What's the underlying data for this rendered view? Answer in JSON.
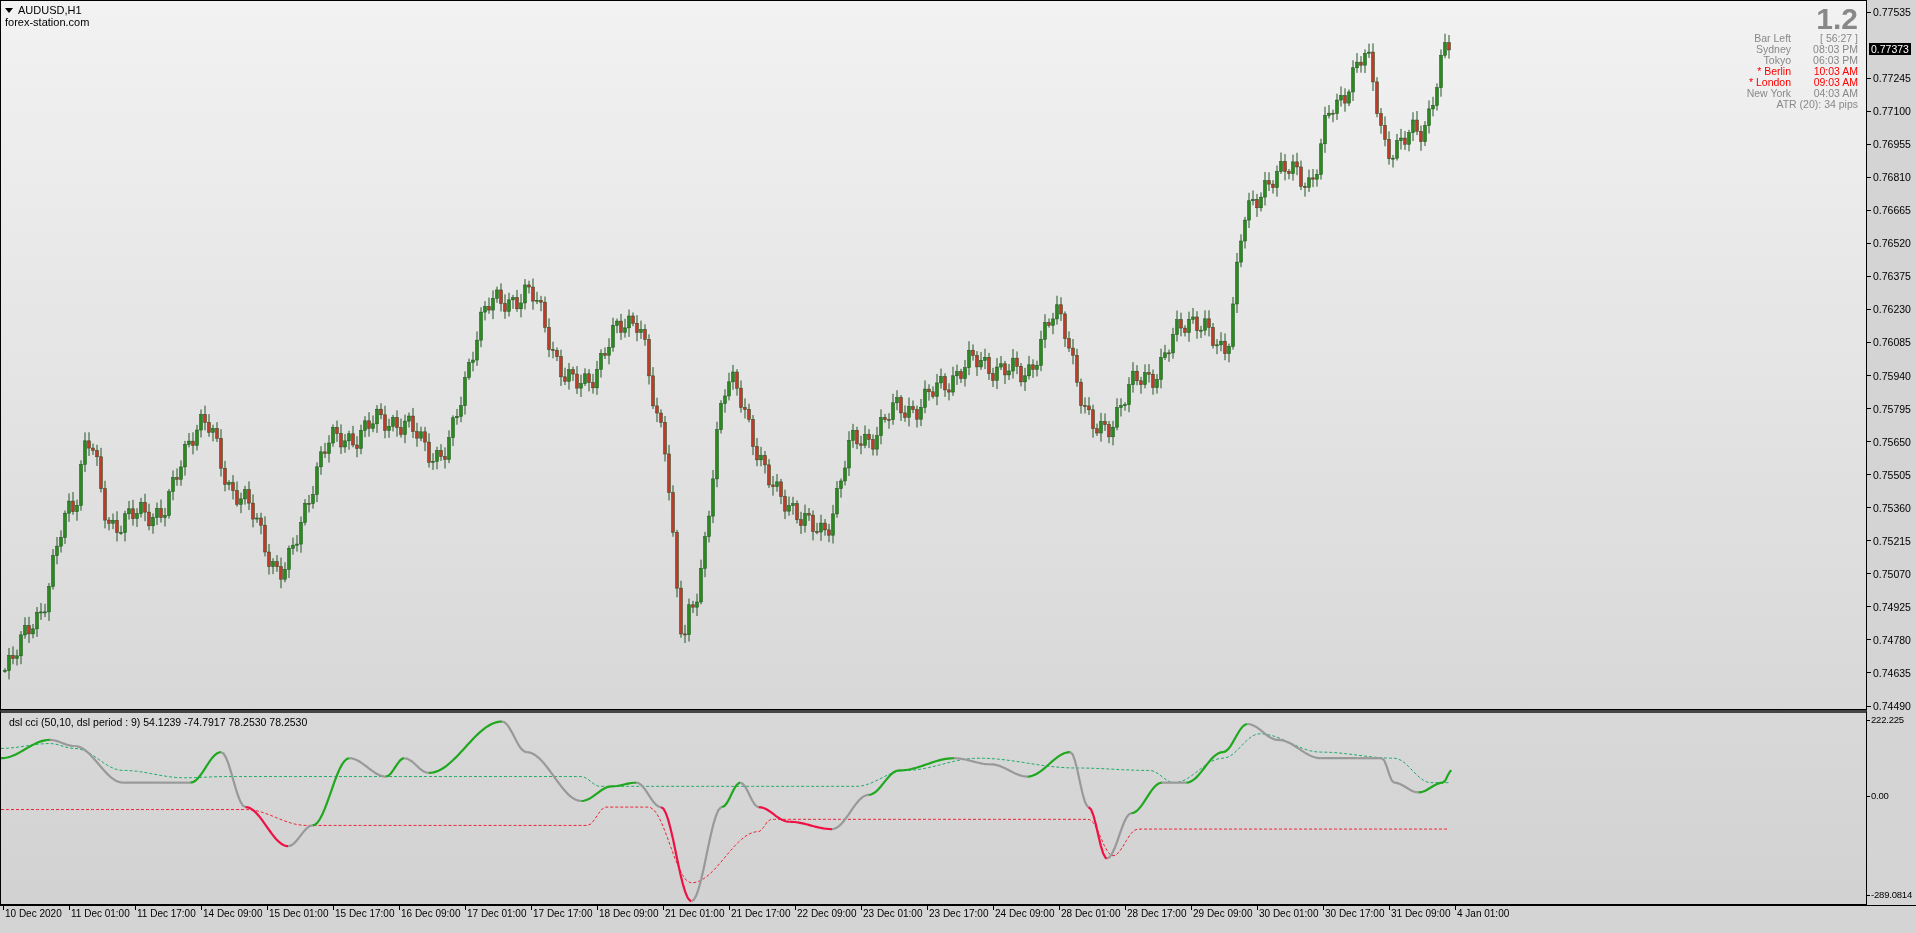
{
  "chart": {
    "title": "AUDUSD,H1",
    "source": "forex-station.com"
  },
  "info_panel": {
    "version": "1.2",
    "rows": [
      {
        "label": "Bar Left",
        "value": "[ 56:27 ]",
        "highlighted": false
      },
      {
        "label": "Sydney",
        "value": "08:03 PM",
        "highlighted": false
      },
      {
        "label": "Tokyo",
        "value": "06:03 PM",
        "highlighted": false
      },
      {
        "label": "* Berlin",
        "value": "10:03 AM",
        "highlighted": true
      },
      {
        "label": "* London",
        "value": "09:03 AM",
        "highlighted": true
      },
      {
        "label": "New York",
        "value": "04:03 AM",
        "highlighted": false
      }
    ],
    "footer": "ATR (20): 34 pips"
  },
  "price_axis": {
    "ticks": [
      "0.77535",
      "0.77245",
      "0.77100",
      "0.76955",
      "0.76810",
      "0.76665",
      "0.76520",
      "0.76375",
      "0.76230",
      "0.76085",
      "0.75940",
      "0.75795",
      "0.75650",
      "0.75505",
      "0.75360",
      "0.75215",
      "0.75070",
      "0.74925",
      "0.74780",
      "0.74635",
      "0.74490"
    ],
    "current_price": "0.77373"
  },
  "indicator": {
    "label": "dsl cci (50,10, dsl period : 9) 54.1239 -74.7917 78.2530 78.2530",
    "ticks": [
      "222.225",
      "0.00",
      "-289.0814"
    ]
  },
  "time_axis": {
    "labels": [
      "10 Dec 2020",
      "11 Dec 01:00",
      "11 Dec 17:00",
      "14 Dec 09:00",
      "15 Dec 01:00",
      "15 Dec 17:00",
      "16 Dec 09:00",
      "17 Dec 01:00",
      "17 Dec 17:00",
      "18 Dec 09:00",
      "21 Dec 01:00",
      "21 Dec 17:00",
      "22 Dec 09:00",
      "23 Dec 01:00",
      "23 Dec 17:00",
      "24 Dec 09:00",
      "28 Dec 01:00",
      "28 Dec 17:00",
      "29 Dec 09:00",
      "30 Dec 01:00",
      "30 Dec 17:00",
      "31 Dec 09:00",
      "4 Jan 01:00"
    ]
  }
}
